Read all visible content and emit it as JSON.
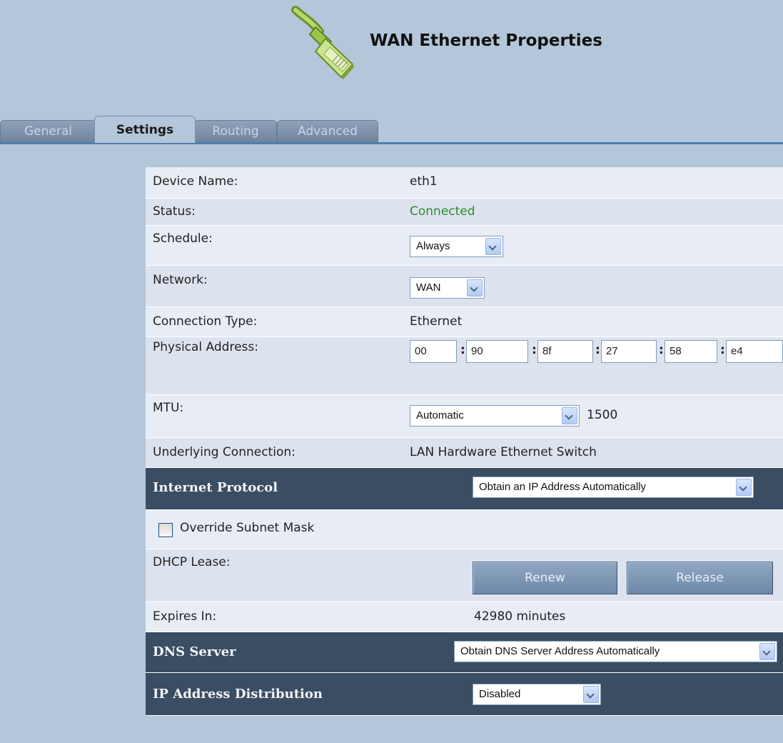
{
  "header": {
    "title": "WAN Ethernet Properties",
    "icon": "ethernet-cable-icon"
  },
  "tabs": [
    {
      "label": "General",
      "active": false
    },
    {
      "label": "Settings",
      "active": true
    },
    {
      "label": "Routing",
      "active": false
    },
    {
      "label": "Advanced",
      "active": false
    }
  ],
  "settings": {
    "device_name_label": "Device Name:",
    "device_name_value": "eth1",
    "status_label": "Status:",
    "status_value": "Connected",
    "status_color": "#2c8c2c",
    "schedule_label": "Schedule:",
    "schedule_value": "Always",
    "network_label": "Network:",
    "network_value": "WAN",
    "connection_type_label": "Connection Type:",
    "connection_type_value": "Ethernet",
    "physical_address_label": "Physical Address:",
    "mac": [
      "00",
      "90",
      "8f",
      "27",
      "58",
      "e4"
    ],
    "mac_separator": ":",
    "mtu_label": "MTU:",
    "mtu_mode": "Automatic",
    "mtu_value": "1500",
    "underlying_label": "Underlying Connection:",
    "underlying_value": "LAN Hardware Ethernet Switch"
  },
  "internet_protocol": {
    "title": "Internet Protocol",
    "mode": "Obtain an IP Address Automatically",
    "override_subnet_label": "Override Subnet Mask",
    "override_subnet_checked": false,
    "dhcp_lease_label": "DHCP Lease:",
    "renew_label": "Renew",
    "release_label": "Release",
    "expires_label": "Expires In:",
    "expires_value": "42980 minutes"
  },
  "dns_server": {
    "title": "DNS Server",
    "mode": "Obtain DNS Server Address Automatically"
  },
  "ip_distribution": {
    "title": "IP Address Distribution",
    "mode": "Disabled"
  },
  "colors": {
    "page_background": "#b4c6d9",
    "section_header": "#3a4d62",
    "row_light": "#e8ecf4",
    "row_alt": "#dde3ee",
    "tab_underline": "#4f7eb0"
  }
}
